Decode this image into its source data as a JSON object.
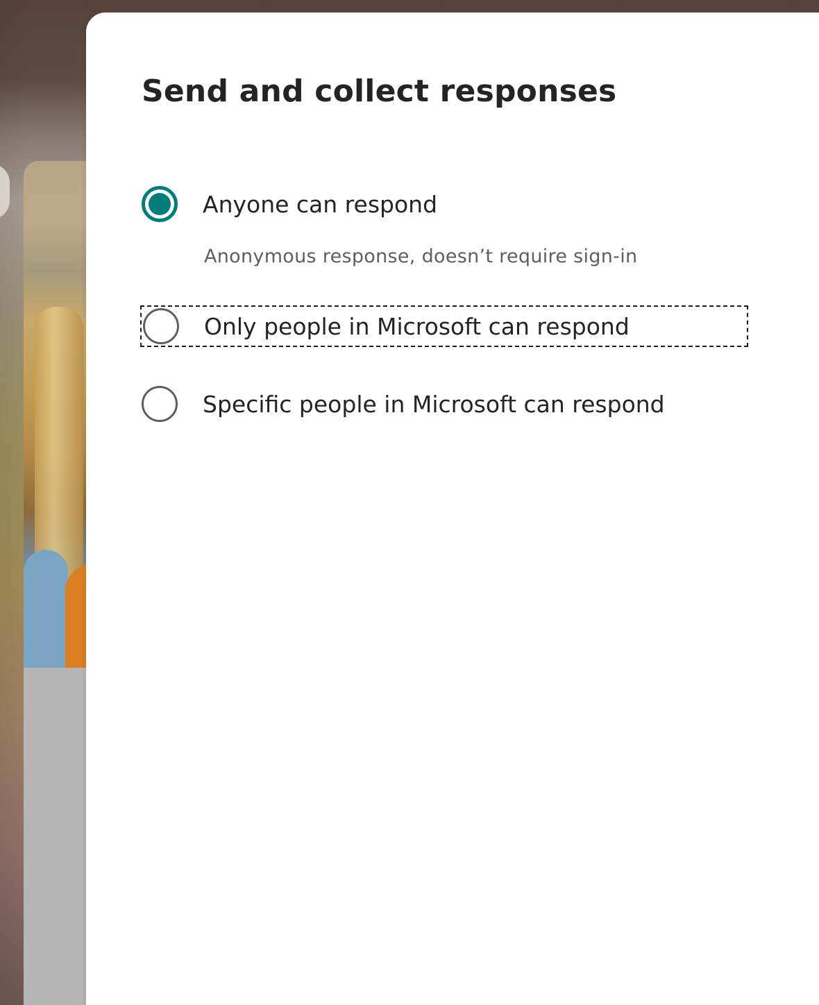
{
  "dialog": {
    "title": "Send and collect responses",
    "accent_color": "#037c7c",
    "options": [
      {
        "label": "Anyone can respond",
        "description": "Anonymous response, doesn’t require sign-in",
        "selected": true
      },
      {
        "label": "Only people in Microsoft can respond",
        "selected": false,
        "focused": true
      },
      {
        "label": "Specific people in Microsoft can respond",
        "selected": false
      }
    ]
  },
  "icons": {
    "selected_radio": "radio-checked-icon",
    "unselected_radio": "radio-unchecked-icon"
  }
}
